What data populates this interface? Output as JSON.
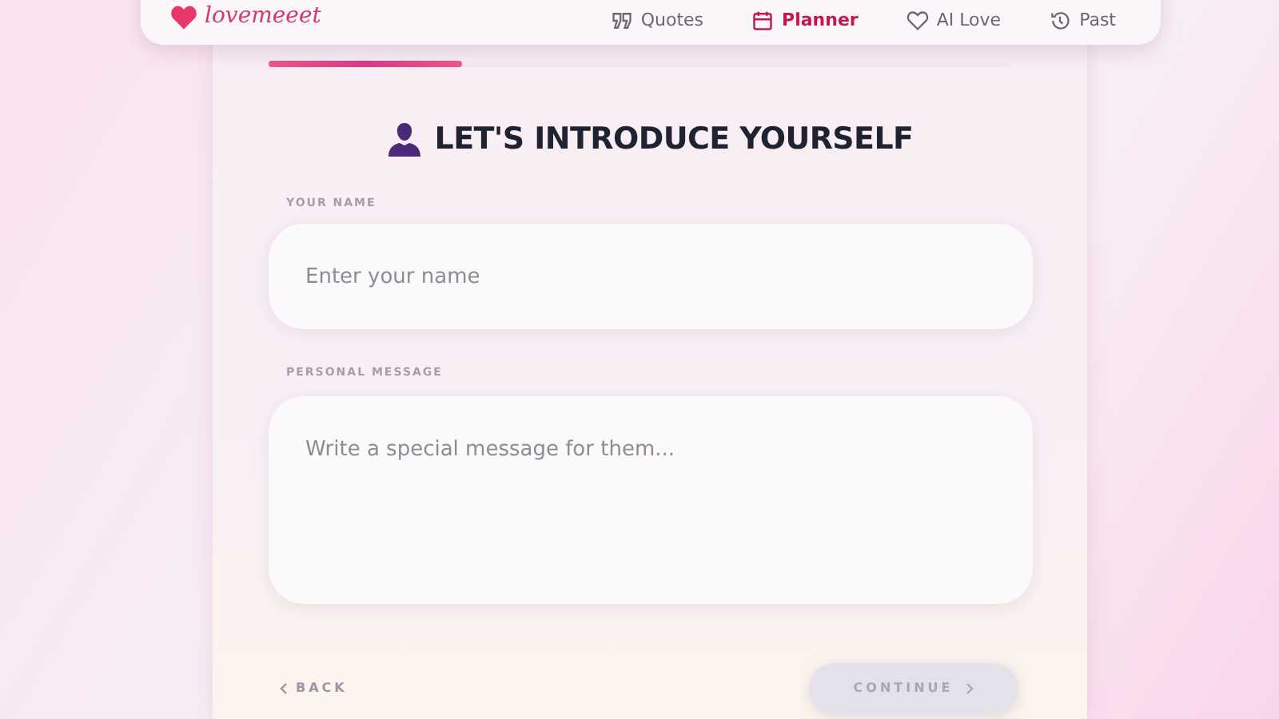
{
  "nav": {
    "logo": "lovemeeet",
    "items": [
      {
        "kind": "quotes",
        "label": "Quotes",
        "selected": false
      },
      {
        "kind": "planner",
        "label": "Planner",
        "selected": true
      },
      {
        "kind": "heart",
        "label": "AI Love",
        "selected": false
      },
      {
        "kind": "history",
        "label": "Past",
        "selected": false
      }
    ]
  },
  "progress": {
    "level": 0.26
  },
  "heading": "LET'S INTRODUCE YOURSELF",
  "fields": [
    {
      "kind": "input",
      "label": "YOUR NAME",
      "placeholder": "Enter your name"
    },
    {
      "kind": "textarea",
      "label": "PERSONAL MESSAGE",
      "placeholder": "Write a special message for them..."
    }
  ],
  "back": {
    "label": "BACK"
  },
  "continue": {
    "label": "CONTINUE",
    "disabled": true
  }
}
